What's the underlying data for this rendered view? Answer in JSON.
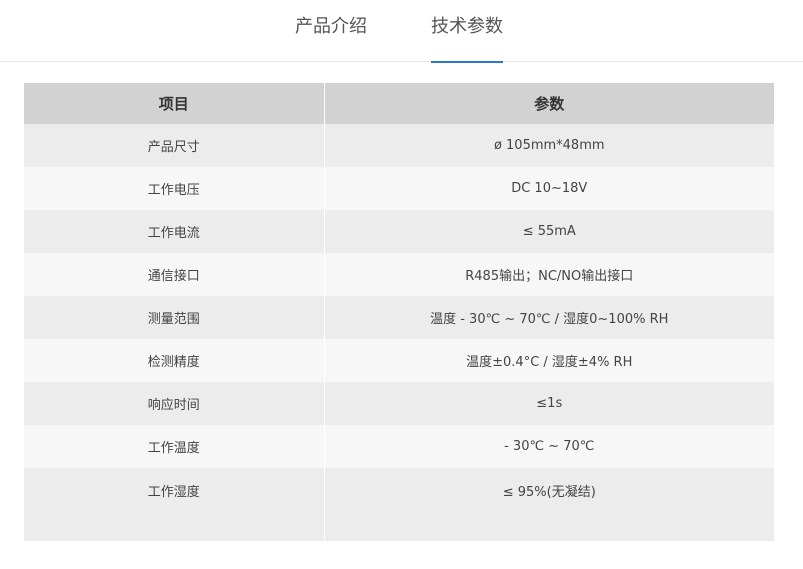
{
  "tabs": [
    {
      "label": "产品介绍",
      "active": false
    },
    {
      "label": "技术参数",
      "active": true
    }
  ],
  "accent_color": "#2c78c9",
  "table": {
    "headers": [
      "项目",
      "参数"
    ],
    "rows": [
      {
        "item": "产品尺寸",
        "value": "ø 105mm*48mm"
      },
      {
        "item": "工作电压",
        "value": "DC 10~18V"
      },
      {
        "item": "工作电流",
        "value": "≤ 55mA"
      },
      {
        "item": "通信接口",
        "value": "R485输出；NC/NO输出接口"
      },
      {
        "item": "测量范围",
        "value": "温度 - 30℃ ~ 70℃ / 湿度0~100% RH"
      },
      {
        "item": "检测精度",
        "value": "温度±0.4°C / 湿度±4% RH"
      },
      {
        "item": "响应时间",
        "value": "≤1s"
      },
      {
        "item": "工作温度",
        "value": "- 30℃ ~ 70℃"
      },
      {
        "item": "工作湿度",
        "value": "≤ 95%(无凝结)"
      }
    ]
  }
}
